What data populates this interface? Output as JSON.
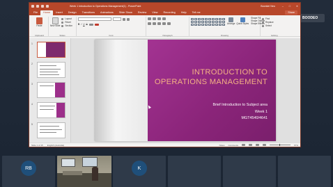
{
  "meeting": {
    "badge_initial": "B",
    "badge_name": "BOODEO",
    "participants": [
      {
        "initials": "RB"
      },
      {
        "initials": "K"
      }
    ]
  },
  "window": {
    "title": "Week 1 Introduction to Operations Management(1) - PowerPoint",
    "user": "Boonkei Neo",
    "controls": [
      "–",
      "□",
      "✕"
    ]
  },
  "ribbon": {
    "tabs": [
      "File",
      "Home",
      "Insert",
      "Design",
      "Transitions",
      "Animations",
      "Slide Show",
      "Review",
      "View",
      "Recording",
      "Help",
      "Tell me"
    ],
    "active_tab": "Home",
    "share_label": "Share",
    "groups": {
      "clipboard": {
        "label": "Clipboard",
        "paste": "Paste"
      },
      "slides": {
        "label": "Slides",
        "new_slide": "New Slide",
        "layout": "Layout",
        "reset": "Reset",
        "section": "Section"
      },
      "font": {
        "label": "Font",
        "bold": "B",
        "italic": "I",
        "underline": "U",
        "strike": "S"
      },
      "paragraph": {
        "label": "Paragraph"
      },
      "drawing": {
        "label": "Drawing",
        "arrange": "Arrange",
        "quick_styles": "Quick Styles",
        "shape_fill": "Shape Fill",
        "shape_outline": "Shape Outline",
        "shape_effects": "Shape Effects"
      },
      "editing": {
        "label": "Editing",
        "find": "Find",
        "replace": "Replace",
        "select": "Select"
      }
    }
  },
  "slide": {
    "title_line1": "INTRODUCTION TO",
    "title_line2": "OPERATIONS MANAGEMENT",
    "subtitle_line1": "Brief Introduction to Subject area",
    "subtitle_line2": "Week 1",
    "subtitle_line3": "MGT4540/4641"
  },
  "thumbnails": [
    {
      "number": "1"
    },
    {
      "number": "2"
    },
    {
      "number": "3"
    },
    {
      "number": "4"
    },
    {
      "number": "5"
    }
  ],
  "status": {
    "slide_counter": "Slide 1 of 15",
    "language": "English (Australia)",
    "notes": "Notes",
    "comments": "Comments",
    "zoom": "67%"
  },
  "colors": {
    "ppt_accent": "#b7472a",
    "slide_magenta": "#9a2d87",
    "slide_title": "#f4b183"
  }
}
